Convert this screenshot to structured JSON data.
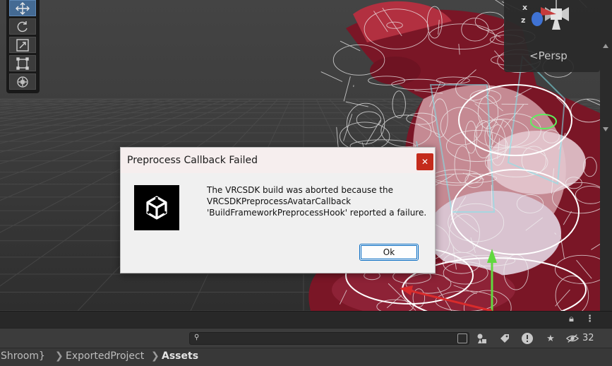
{
  "viewport": {
    "gizmo": {
      "x_label": "x",
      "z_label": "z",
      "projection_label": "Persp"
    }
  },
  "tools": [
    {
      "name": "move",
      "icon": "move-tool-icon",
      "active": true
    },
    {
      "name": "rotate",
      "icon": "rotate-tool-icon",
      "active": false
    },
    {
      "name": "scale",
      "icon": "scale-tool-icon",
      "active": false
    },
    {
      "name": "rect",
      "icon": "rect-tool-icon",
      "active": false
    },
    {
      "name": "transform",
      "icon": "transform-tool-icon",
      "active": false
    }
  ],
  "dialog": {
    "title": "Preprocess Callback Failed",
    "message_lines": [
      "The VRCSDK build was aborted because the",
      "VRCSDKPreprocessAvatarCallback",
      "'BuildFrameworkPreprocessHook' reported a failure."
    ],
    "ok_label": "Ok",
    "close_glyph": "✕",
    "icon": "unity-logo-icon"
  },
  "project_panel": {
    "hidden_count": "32",
    "breadcrumb": [
      "Shroom}",
      "ExportedProject",
      "Assets"
    ],
    "breadcrumb_sep": "❯"
  },
  "colors": {
    "dialog_close": "#c42b1c",
    "ok_border": "#0067c0",
    "active_tool": "#446a93"
  }
}
